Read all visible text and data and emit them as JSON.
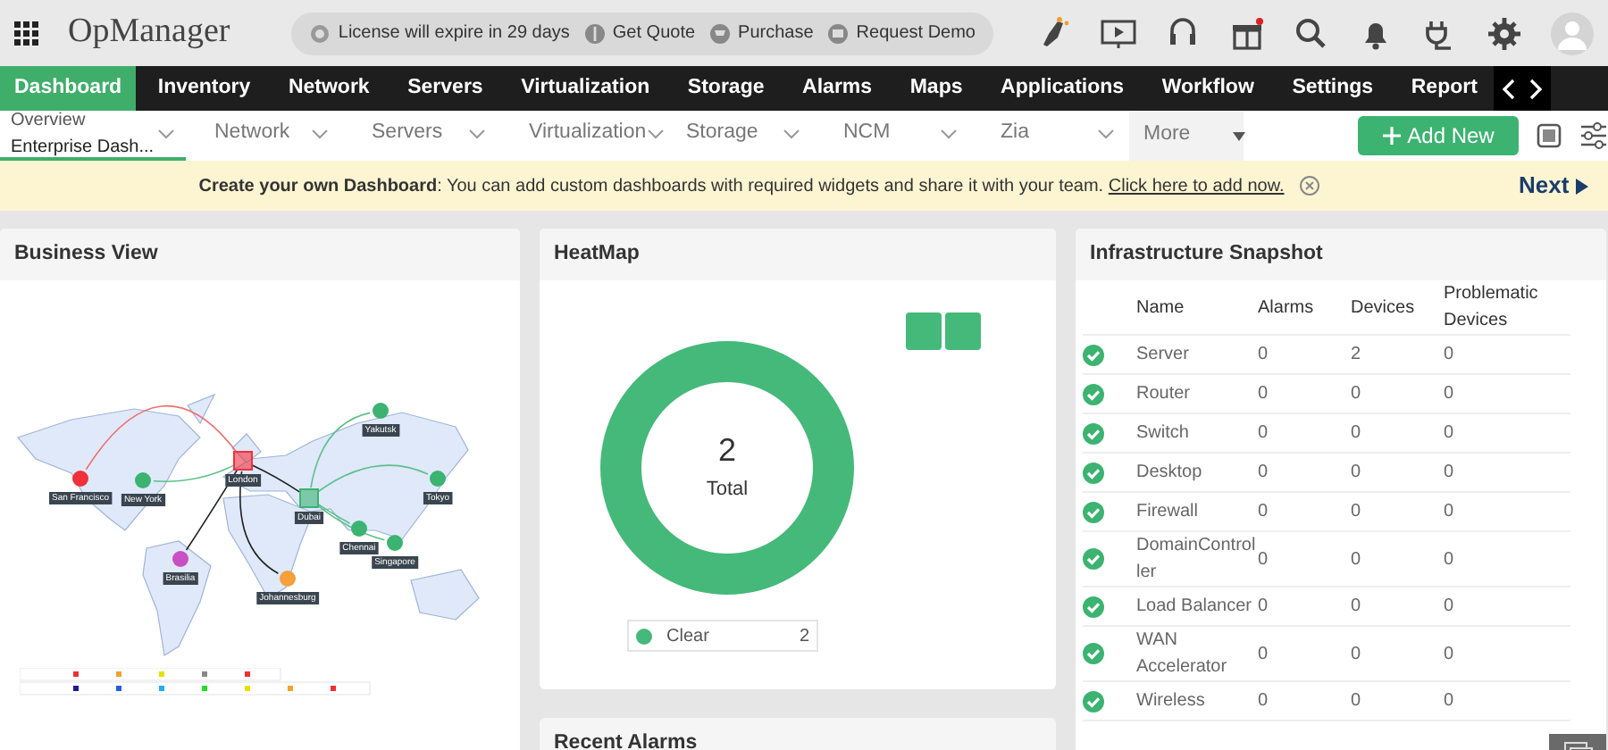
{
  "app": {
    "title": "OpManager"
  },
  "notice": {
    "items": [
      {
        "kind": "license",
        "label": "License will expire in 29 days"
      },
      {
        "kind": "quote",
        "label": "Get Quote"
      },
      {
        "kind": "purchase",
        "label": "Purchase"
      },
      {
        "kind": "demo",
        "label": "Request Demo"
      }
    ]
  },
  "main_nav": [
    {
      "label": "Dashboard",
      "selected": true
    },
    {
      "label": "Inventory",
      "selected": false
    },
    {
      "label": "Network",
      "selected": false
    },
    {
      "label": "Servers",
      "selected": false
    },
    {
      "label": "Virtualization",
      "selected": false
    },
    {
      "label": "Storage",
      "selected": false
    },
    {
      "label": "Alarms",
      "selected": false
    },
    {
      "label": "Maps",
      "selected": false
    },
    {
      "label": "Applications",
      "selected": false
    },
    {
      "label": "Workflow",
      "selected": false
    },
    {
      "label": "Settings",
      "selected": false
    },
    {
      "label": "Report",
      "selected": false
    }
  ],
  "sub_nav": [
    {
      "label": "Overview",
      "value": "Enterprise Dash...",
      "selected": true
    },
    {
      "label": "Network",
      "selected": false
    },
    {
      "label": "Servers",
      "selected": false
    },
    {
      "label": "Virtualization",
      "selected": false
    },
    {
      "label": "Storage",
      "selected": false
    },
    {
      "label": "NCM",
      "selected": false
    },
    {
      "label": "Zia",
      "selected": false
    }
  ],
  "more": {
    "label": "More"
  },
  "add_button": {
    "label": "Add New"
  },
  "banner": {
    "text": "**Create your own Dashboard**: You can add custom dashboards with required widgets and share it with your team.",
    "link": "Click here to add now.",
    "next": "Next"
  },
  "business_view": {
    "title": "Business View",
    "cities": [
      {
        "name": "San Francisco",
        "color": "#f0303a",
        "kind": "site"
      },
      {
        "name": "New York",
        "color": "#3cb371",
        "kind": "site"
      },
      {
        "name": "London",
        "color": "#f0303a",
        "kind": "hub"
      },
      {
        "name": "Dubai",
        "color": "#3cb371",
        "kind": "hub"
      },
      {
        "name": "Yakutsk",
        "color": "#3cb371",
        "kind": "site"
      },
      {
        "name": "Tokyo",
        "color": "#3cb371",
        "kind": "site"
      },
      {
        "name": "Chennai",
        "color": "#3cb371",
        "kind": "site"
      },
      {
        "name": "Singapore",
        "color": "#3cb371",
        "kind": "site"
      },
      {
        "name": "Brasilia",
        "color": "#c84fc4",
        "kind": "site"
      },
      {
        "name": "Johannesburg",
        "color": "#f5a03a",
        "kind": "site"
      }
    ]
  },
  "heatmap": {
    "title": "HeatMap",
    "total": "2",
    "total_label": "Total",
    "tiles": [
      {
        "color": "#45b97a"
      },
      {
        "color": "#45b97a"
      }
    ],
    "legend": [
      {
        "label": "Clear",
        "count": "2",
        "color": "#45b97a"
      }
    ]
  },
  "recent_alarms": {
    "title": "Recent Alarms"
  },
  "snapshot": {
    "title": "Infrastructure Snapshot",
    "columns": [
      "Name",
      "Alarms",
      "Devices",
      "Problematic Devices"
    ],
    "rows": [
      [
        "Server",
        "0",
        "2",
        "0"
      ],
      [
        "Router",
        "0",
        "0",
        "0"
      ],
      [
        "Switch",
        "0",
        "0",
        "0"
      ],
      [
        "Desktop",
        "0",
        "0",
        "0"
      ],
      [
        "Firewall",
        "0",
        "0",
        "0"
      ],
      [
        "DomainController",
        "0",
        "0",
        "0"
      ],
      [
        "Load Balancer",
        "0",
        "0",
        "0"
      ],
      [
        "WAN Accelerator",
        "0",
        "0",
        "0"
      ],
      [
        "Wireless",
        "0",
        "0",
        "0"
      ]
    ]
  }
}
